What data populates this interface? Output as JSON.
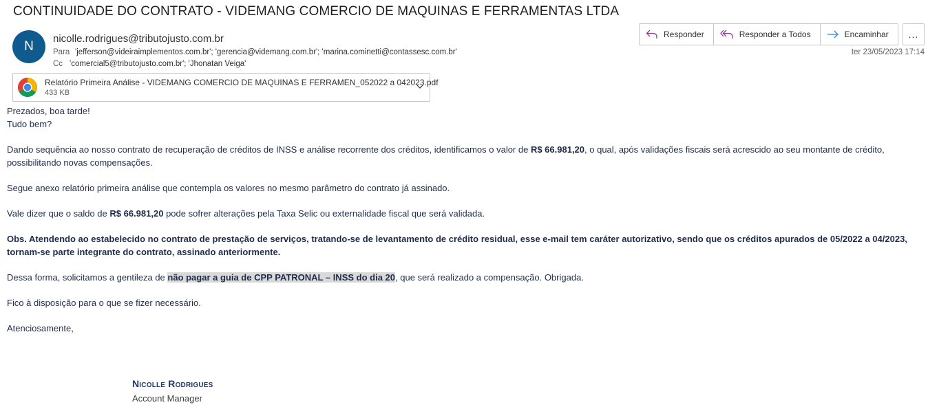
{
  "email": {
    "subject": "CONTINUIDADE DO CONTRATO - VIDEMANG COMERCIO DE MAQUINAS E FERRAMENTAS LTDA",
    "avatar_initial": "N",
    "sender": "nicolle.rodrigues@tributojusto.com.br",
    "to_label": "Para",
    "to": "'jefferson@videiraimplementos.com.br'; 'gerencia@videmang.com.br'; 'marina.cominetti@contassesc.com.br'",
    "cc_label": "Cc",
    "cc": "'comercial5@tributojusto.com.br'; 'Jhonatan Veiga'",
    "date": "ter 23/05/2023 17:14"
  },
  "actions": {
    "reply": "Responder",
    "reply_all": "Responder a Todos",
    "forward": "Encaminhar",
    "more": "..."
  },
  "attachment": {
    "icon": "chrome-icon",
    "name": "Relatório Primeira Análise - VIDEMANG COMERCIO DE MAQUINAS E FERRAMEN_052022 a 042023.pdf",
    "size": "433 KB"
  },
  "body": {
    "greeting1": "Prezados, boa tarde!",
    "greeting2": "Tudo bem?",
    "p1_a": "Dando sequência ao nosso contrato de recuperação de créditos de INSS e análise recorrente dos créditos, identificamos o valor de ",
    "p1_amount": "R$ 66.981,20",
    "p1_b": ", o qual, após validações fiscais será acrescido ao seu montante de crédito, possibilitando novas compensações.",
    "p2": "Segue anexo relatório primeira análise que contempla os valores no mesmo parâmetro do contrato já assinado.",
    "p3_a": "Vale dizer que o saldo de ",
    "p3_amount": "R$ 66.981,20",
    "p3_b": " pode sofrer alterações pela Taxa Selic ou externalidade fiscal que será validada.",
    "obs": "Obs. Atendendo ao estabelecido no contrato de prestação de serviços, tratando-se de levantamento de crédito residual, esse e-mail tem caráter autorizativo, sendo que os créditos apurados de 05/2022 a 04/2023, tornam-se parte integrante do contrato, assinado anteriormente.",
    "p4_a": "Dessa forma, solicitamos a gentileza de ",
    "p4_highlight": "não pagar a guia de CPP PATRONAL – INSS do dia 20",
    "p4_b": ", que será realizado a compensação. Obrigada.",
    "p5": "Fico à disposição para o que se fizer necessário.",
    "closing": "Atenciosamente,"
  },
  "signature": {
    "name": "Nicolle Rodrigues",
    "role": "Account Manager"
  },
  "colors": {
    "avatar": "#0f5a8e",
    "reply_icon": "#8c3c8c",
    "forward_icon": "#2b88d8",
    "body_text": "#1f2d4d",
    "highlight": "#d9d9d9"
  }
}
